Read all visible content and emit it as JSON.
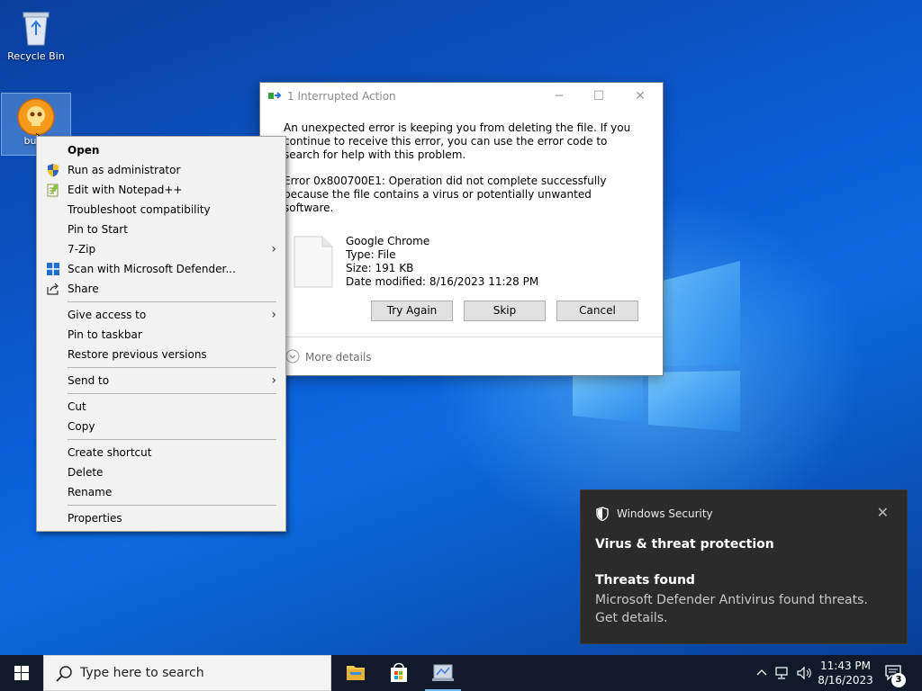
{
  "desktop": {
    "icons": [
      {
        "label": "Recycle Bin",
        "icon": "recycle-bin-icon"
      },
      {
        "label": "build",
        "icon": "skull-icon"
      }
    ]
  },
  "context_menu": {
    "items": [
      {
        "label": "Open",
        "bold": true
      },
      {
        "label": "Run as administrator",
        "icon": "uac-shield-icon"
      },
      {
        "label": "Edit with Notepad++",
        "icon": "notepad-icon"
      },
      {
        "label": "Troubleshoot compatibility"
      },
      {
        "label": "Pin to Start"
      },
      {
        "label": "7-Zip",
        "submenu": true
      },
      {
        "label": "Scan with Microsoft Defender...",
        "icon": "defender-icon"
      },
      {
        "label": "Share",
        "icon": "share-icon"
      },
      {
        "label": "Give access to",
        "submenu": true
      },
      {
        "label": "Pin to taskbar"
      },
      {
        "label": "Restore previous versions"
      },
      {
        "label": "Send to",
        "submenu": true
      },
      {
        "label": "Cut"
      },
      {
        "label": "Copy"
      },
      {
        "label": "Create shortcut"
      },
      {
        "label": "Delete"
      },
      {
        "label": "Rename"
      },
      {
        "label": "Properties"
      }
    ]
  },
  "dialog": {
    "title": "1 Interrupted Action",
    "message": "An unexpected error is keeping you from deleting the file. If you continue to receive this error, you can use the error code to search for help with this problem.",
    "error": "Error 0x800700E1: Operation did not complete successfully because the file contains a virus or potentially unwanted software.",
    "file": {
      "name": "Google Chrome",
      "type": "Type: File",
      "size": "Size: 191 KB",
      "modified": "Date modified: 8/16/2023 11:28 PM"
    },
    "buttons": {
      "try_again": "Try Again",
      "skip": "Skip",
      "cancel": "Cancel"
    },
    "more_details": "More details"
  },
  "toast": {
    "app": "Windows Security",
    "heading": "Virus & threat protection",
    "subheading": "Threats found",
    "body": "Microsoft Defender Antivirus found threats. Get details."
  },
  "taskbar": {
    "search_placeholder": "Type here to search",
    "apps": [
      "file-explorer-icon",
      "microsoft-store-icon",
      "control-panel-icon"
    ],
    "time": "11:43 PM",
    "date": "8/16/2023",
    "notification_count": "3"
  },
  "colors": {
    "accent": "#0078d7",
    "toast_bg": "#2b2b2b",
    "taskbar_bg": "#101a2a"
  }
}
